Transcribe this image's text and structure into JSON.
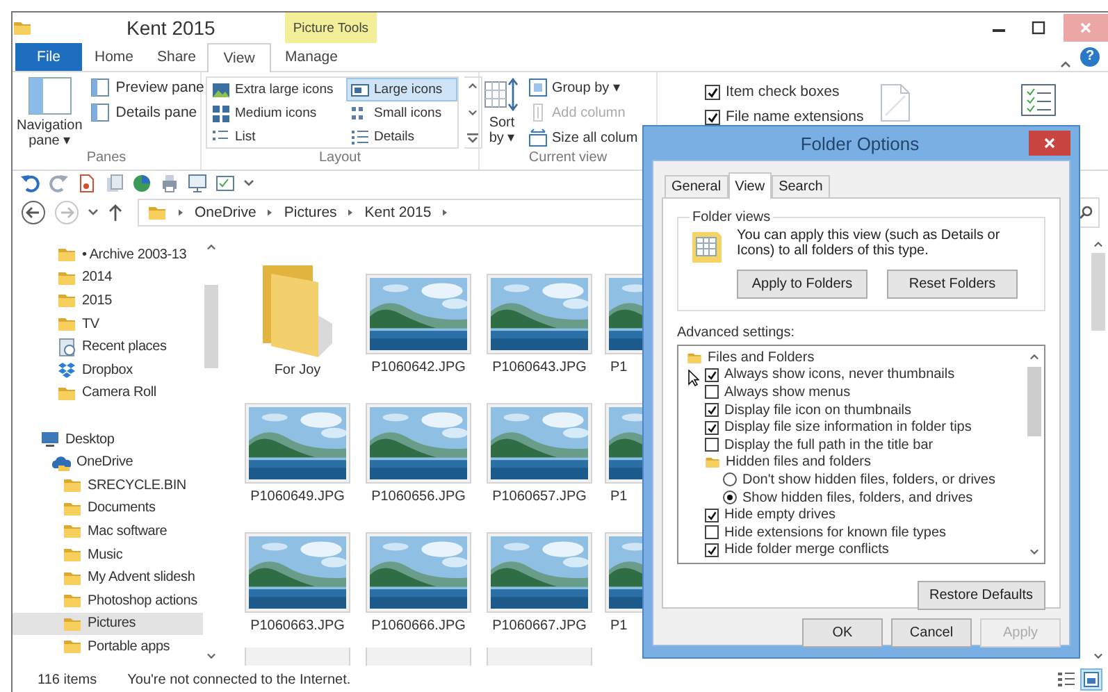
{
  "window": {
    "title": "Kent 2015",
    "context_tab": "Picture Tools"
  },
  "ribbon": {
    "tabs": [
      {
        "label": "File",
        "kind": "file",
        "selected": false
      },
      {
        "label": "Home",
        "kind": "tab",
        "selected": false
      },
      {
        "label": "Share",
        "kind": "tab",
        "selected": false
      },
      {
        "label": "View",
        "kind": "tab",
        "selected": true
      },
      {
        "label": "Manage",
        "kind": "tab",
        "selected": false
      }
    ],
    "help": "?",
    "panes": {
      "label": "Panes",
      "navigation": "Navigation pane ▾",
      "items": [
        "Preview pane",
        "Details pane"
      ]
    },
    "layout": {
      "label": "Layout",
      "items": [
        {
          "label": "Extra large icons",
          "selected": false
        },
        {
          "label": "Large icons",
          "selected": true
        },
        {
          "label": "Medium icons",
          "selected": false
        },
        {
          "label": "Small icons",
          "selected": false
        },
        {
          "label": "List",
          "selected": false
        },
        {
          "label": "Details",
          "selected": false
        }
      ]
    },
    "current_view": {
      "label": "Current view",
      "sort": "Sort by ▾",
      "items": [
        {
          "label": "Group by ▾",
          "disabled": false
        },
        {
          "label": "Add column",
          "disabled": true
        },
        {
          "label": "Size all colum",
          "disabled": false
        }
      ]
    },
    "show_hide": [
      {
        "label": "Item check boxes",
        "checked": true
      },
      {
        "label": "File name extensions",
        "checked": true
      }
    ]
  },
  "address": {
    "crumbs": [
      "OneDrive",
      "Pictures",
      "Kent 2015"
    ]
  },
  "navigation": {
    "favorites": [
      {
        "label": "• Archive 2003-13",
        "kind": "folder",
        "selected": false
      },
      {
        "label": "2014",
        "kind": "folder",
        "selected": false
      },
      {
        "label": "2015",
        "kind": "folder",
        "selected": false
      },
      {
        "label": "TV",
        "kind": "folder",
        "selected": false
      },
      {
        "label": "Recent places",
        "kind": "recent",
        "selected": false
      },
      {
        "label": "Dropbox",
        "kind": "dropbox",
        "selected": false
      },
      {
        "label": "Camera Roll",
        "kind": "folder",
        "selected": false
      }
    ],
    "tree": [
      {
        "label": "Desktop",
        "kind": "desktop",
        "selected": false,
        "children": [
          {
            "label": "OneDrive",
            "kind": "onedrive",
            "selected": false,
            "children": [
              {
                "label": "SRECYCLE.BIN",
                "kind": "folder",
                "selected": false
              },
              {
                "label": "Documents",
                "kind": "folder",
                "selected": false
              },
              {
                "label": "Mac software",
                "kind": "folder",
                "selected": false
              },
              {
                "label": "Music",
                "kind": "folder",
                "selected": false
              },
              {
                "label": "My Advent slidesh",
                "kind": "folder",
                "selected": false
              },
              {
                "label": "Photoshop actions",
                "kind": "folder",
                "selected": false
              },
              {
                "label": "Pictures",
                "kind": "folder",
                "selected": true
              },
              {
                "label": "Portable apps",
                "kind": "folder",
                "selected": false
              }
            ]
          }
        ]
      }
    ]
  },
  "content": {
    "items": [
      {
        "label": "For Joy",
        "kind": "folder"
      },
      {
        "label": "P1060642.JPG",
        "kind": "picture"
      },
      {
        "label": "P1060643.JPG",
        "kind": "picture"
      },
      {
        "label": "P1",
        "kind": "picture"
      },
      {
        "label": "P1060649.JPG",
        "kind": "picture"
      },
      {
        "label": "P1060656.JPG",
        "kind": "picture"
      },
      {
        "label": "P1060657.JPG",
        "kind": "picture"
      },
      {
        "label": "P1",
        "kind": "picture"
      },
      {
        "label": "P1060663.JPG",
        "kind": "picture"
      },
      {
        "label": "P1060666.JPG",
        "kind": "picture"
      },
      {
        "label": "P1060667.JPG",
        "kind": "picture"
      },
      {
        "label": "P1",
        "kind": "picture"
      }
    ]
  },
  "status_bar": {
    "item_count": "116 items",
    "message": "You're not connected to the Internet.",
    "views": [
      {
        "kind": "details",
        "selected": false
      },
      {
        "kind": "large-icons",
        "selected": true
      }
    ]
  },
  "dialog": {
    "title": "Folder Options",
    "tabs": [
      {
        "label": "General",
        "selected": false
      },
      {
        "label": "View",
        "selected": true
      },
      {
        "label": "Search",
        "selected": false
      }
    ],
    "folder_views": {
      "heading": "Folder views",
      "text": "You can apply this view (such as Details or Icons) to all folders of this type.",
      "buttons": [
        "Apply to Folders",
        "Reset Folders"
      ]
    },
    "advanced_label": "Advanced settings:",
    "settings": [
      {
        "kind": "folder",
        "label": "Files and Folders",
        "children": [
          {
            "kind": "checkbox",
            "label": "Always show icons, never thumbnails",
            "checked": true
          },
          {
            "kind": "checkbox",
            "label": "Always show menus",
            "checked": false
          },
          {
            "kind": "checkbox",
            "label": "Display file icon on thumbnails",
            "checked": true
          },
          {
            "kind": "checkbox",
            "label": "Display file size information in folder tips",
            "checked": true
          },
          {
            "kind": "checkbox",
            "label": "Display the full path in the title bar",
            "checked": false
          },
          {
            "kind": "folder",
            "label": "Hidden files and folders",
            "children": [
              {
                "kind": "radio",
                "label": "Don't show hidden files, folders, or drives",
                "selected": false
              },
              {
                "kind": "radio",
                "label": "Show hidden files, folders, and drives",
                "selected": true
              }
            ]
          },
          {
            "kind": "checkbox",
            "label": "Hide empty drives",
            "checked": true
          },
          {
            "kind": "checkbox",
            "label": "Hide extensions for known file types",
            "checked": false
          },
          {
            "kind": "checkbox",
            "label": "Hide folder merge conflicts",
            "checked": true
          }
        ]
      }
    ],
    "restore_button": "Restore Defaults",
    "buttons": [
      {
        "label": "OK",
        "disabled": false
      },
      {
        "label": "Cancel",
        "disabled": false
      },
      {
        "label": "Apply",
        "disabled": true
      }
    ]
  }
}
